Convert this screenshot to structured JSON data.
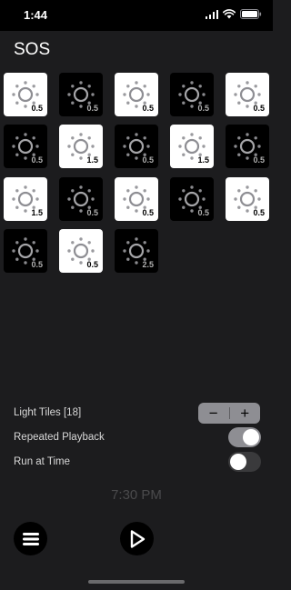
{
  "status_bar": {
    "time": "1:44"
  },
  "title": "SOS",
  "tiles": [
    {
      "color": "white",
      "value": "0.5"
    },
    {
      "color": "black",
      "value": "0.5"
    },
    {
      "color": "white",
      "value": "0.5"
    },
    {
      "color": "black",
      "value": "0.5"
    },
    {
      "color": "white",
      "value": "0.5"
    },
    {
      "color": "black",
      "value": "0.5"
    },
    {
      "color": "white",
      "value": "1.5"
    },
    {
      "color": "black",
      "value": "0.5"
    },
    {
      "color": "white",
      "value": "1.5"
    },
    {
      "color": "black",
      "value": "0.5"
    },
    {
      "color": "white",
      "value": "1.5"
    },
    {
      "color": "black",
      "value": "0.5"
    },
    {
      "color": "white",
      "value": "0.5"
    },
    {
      "color": "black",
      "value": "0.5"
    },
    {
      "color": "white",
      "value": "0.5"
    },
    {
      "color": "black",
      "value": "0.5"
    },
    {
      "color": "white",
      "value": "0.5"
    },
    {
      "color": "black",
      "value": "2.5"
    }
  ],
  "settings": {
    "light_tiles_label": "Light Tiles [18]",
    "stepper_minus": "−",
    "stepper_plus": "+",
    "repeated_playback_label": "Repeated Playback",
    "repeated_playback_on": true,
    "run_at_time_label": "Run at Time",
    "run_at_time_on": false,
    "time_value": "7:30 PM"
  },
  "icons": {
    "tile_icon": "sun-icon",
    "menu": "menu-icon",
    "play": "play-icon"
  },
  "colors": {
    "background": "#1c1c1e",
    "tile_white": "#ffffff",
    "tile_black": "#000000",
    "control_gray": "#8e8e93"
  }
}
